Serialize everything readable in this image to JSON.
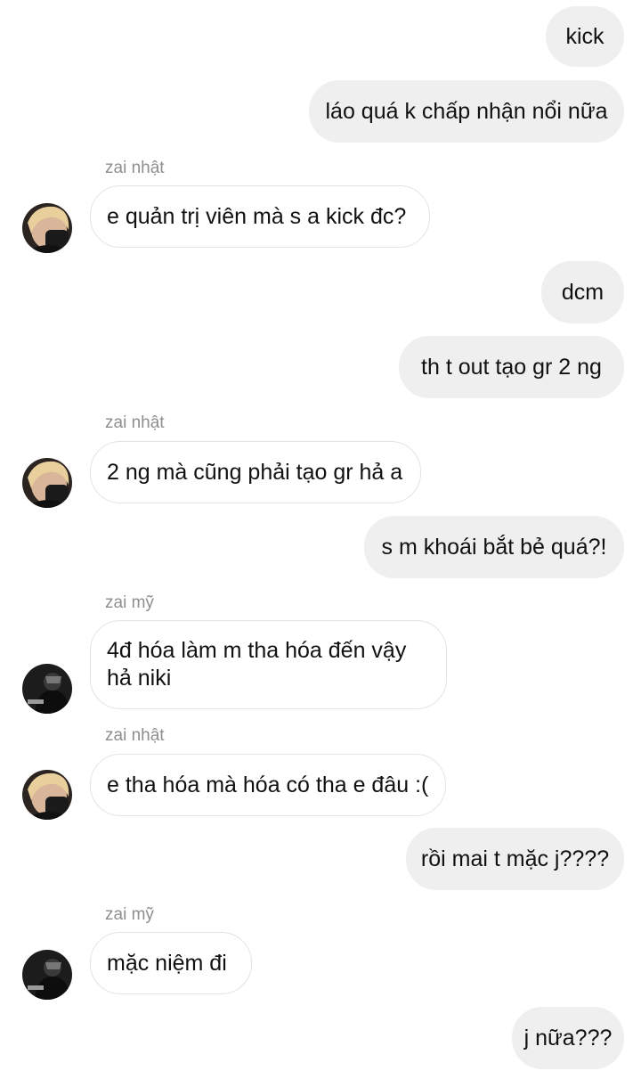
{
  "messages": [
    {
      "id": "m1",
      "direction": "outgoing",
      "text": "kick"
    },
    {
      "id": "m2",
      "direction": "outgoing",
      "text": "láo quá k chấp nhận nổi nữa"
    },
    {
      "id": "m3",
      "direction": "incoming",
      "sender": "zai nhật",
      "avatar": "avatar-blonde-icon",
      "text": "e quản trị viên mà s a kick đc?"
    },
    {
      "id": "m4",
      "direction": "outgoing",
      "text": "dcm"
    },
    {
      "id": "m5",
      "direction": "outgoing",
      "text": "th t out tạo gr 2 ng"
    },
    {
      "id": "m6",
      "direction": "incoming",
      "sender": "zai nhật",
      "avatar": "avatar-blonde-icon",
      "text": "2 ng mà cũng phải tạo gr hả a"
    },
    {
      "id": "m7",
      "direction": "outgoing",
      "text": "s m khoái bắt bẻ quá?!"
    },
    {
      "id": "m8",
      "direction": "incoming",
      "sender": "zai mỹ",
      "avatar": "avatar-dark-icon",
      "text_line1": "4đ hóa làm m tha hóa đến vậy",
      "text_line2": "hả niki"
    },
    {
      "id": "m9",
      "direction": "incoming",
      "sender": "zai nhật",
      "avatar": "avatar-blonde-icon",
      "text": "e tha hóa mà hóa có tha e đâu :("
    },
    {
      "id": "m10",
      "direction": "outgoing",
      "text": "rồi mai t mặc j????"
    },
    {
      "id": "m11",
      "direction": "incoming",
      "sender": "zai mỹ",
      "avatar": "avatar-dark-icon",
      "text": "mặc niệm đi"
    },
    {
      "id": "m12",
      "direction": "outgoing",
      "text": "j nữa???"
    }
  ],
  "colors": {
    "outgoing_bubble": "#efefef",
    "incoming_border": "#e3e3e3",
    "sender_text": "#8e8e8e",
    "message_text": "#111111"
  }
}
